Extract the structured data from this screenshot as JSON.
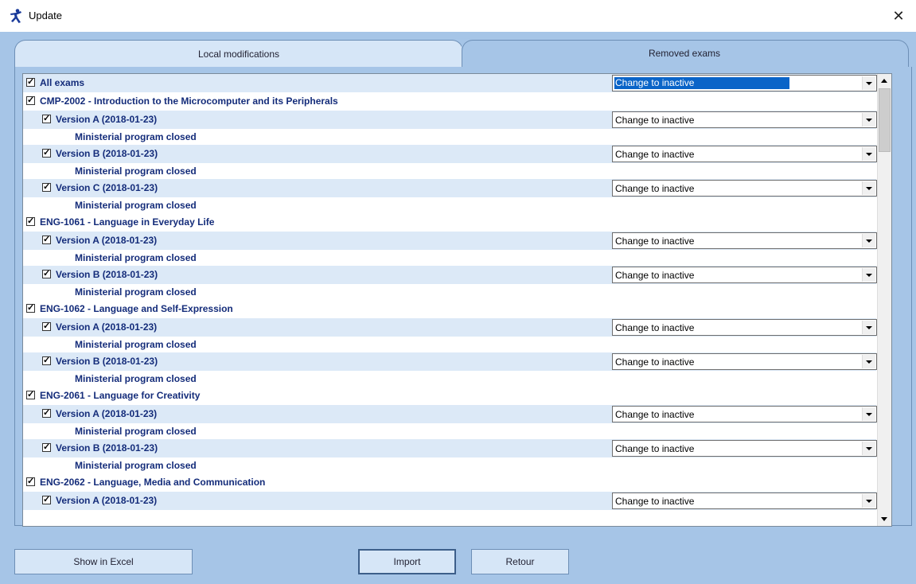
{
  "window": {
    "title": "Update",
    "close_label": "✕"
  },
  "tabs": [
    {
      "label": "Local modifications",
      "active": false
    },
    {
      "label": "Removed exams",
      "active": true
    }
  ],
  "dropdown_value": "Change to inactive",
  "rows": [
    {
      "kind": "all",
      "label": "All exams",
      "checked": true,
      "dropdown": "Change to inactive",
      "selected": true
    },
    {
      "kind": "course",
      "label": "CMP-2002 - Introduction to the Microcomputer and its Peripherals",
      "checked": true
    },
    {
      "kind": "version",
      "label": "Version A   (2018-01-23)",
      "checked": true,
      "dropdown": "Change to inactive"
    },
    {
      "kind": "note",
      "label": "Ministerial program closed"
    },
    {
      "kind": "version",
      "label": "Version B   (2018-01-23)",
      "checked": true,
      "dropdown": "Change to inactive"
    },
    {
      "kind": "note",
      "label": "Ministerial program closed"
    },
    {
      "kind": "version",
      "label": "Version C   (2018-01-23)",
      "checked": true,
      "dropdown": "Change to inactive"
    },
    {
      "kind": "note",
      "label": "Ministerial program closed"
    },
    {
      "kind": "course",
      "label": "ENG-1061 - Language in Everyday Life",
      "checked": true
    },
    {
      "kind": "version",
      "label": "Version A   (2018-01-23)",
      "checked": true,
      "dropdown": "Change to inactive"
    },
    {
      "kind": "note",
      "label": "Ministerial program closed"
    },
    {
      "kind": "version",
      "label": "Version B   (2018-01-23)",
      "checked": true,
      "dropdown": "Change to inactive"
    },
    {
      "kind": "note",
      "label": "Ministerial program closed"
    },
    {
      "kind": "course",
      "label": "ENG-1062 - Language and Self-Expression",
      "checked": true
    },
    {
      "kind": "version",
      "label": "Version A   (2018-01-23)",
      "checked": true,
      "dropdown": "Change to inactive"
    },
    {
      "kind": "note",
      "label": "Ministerial program closed"
    },
    {
      "kind": "version",
      "label": "Version B   (2018-01-23)",
      "checked": true,
      "dropdown": "Change to inactive"
    },
    {
      "kind": "note",
      "label": "Ministerial program closed"
    },
    {
      "kind": "course",
      "label": "ENG-2061 - Language for Creativity",
      "checked": true
    },
    {
      "kind": "version",
      "label": "Version A   (2018-01-23)",
      "checked": true,
      "dropdown": "Change to inactive"
    },
    {
      "kind": "note",
      "label": "Ministerial program closed"
    },
    {
      "kind": "version",
      "label": "Version B   (2018-01-23)",
      "checked": true,
      "dropdown": "Change to inactive"
    },
    {
      "kind": "note",
      "label": "Ministerial program closed"
    },
    {
      "kind": "course",
      "label": "ENG-2062 - Language, Media and Communication",
      "checked": true
    },
    {
      "kind": "version",
      "label": "Version A   (2018-01-23)",
      "checked": true,
      "dropdown": "Change to inactive"
    }
  ],
  "buttons": {
    "excel": "Show in Excel",
    "import": "Import",
    "retour": "Retour"
  },
  "colors": {
    "background": "#a6c5e7",
    "row_shade": "#dce9f7",
    "text": "#142c7a",
    "selection": "#0a64c8"
  }
}
